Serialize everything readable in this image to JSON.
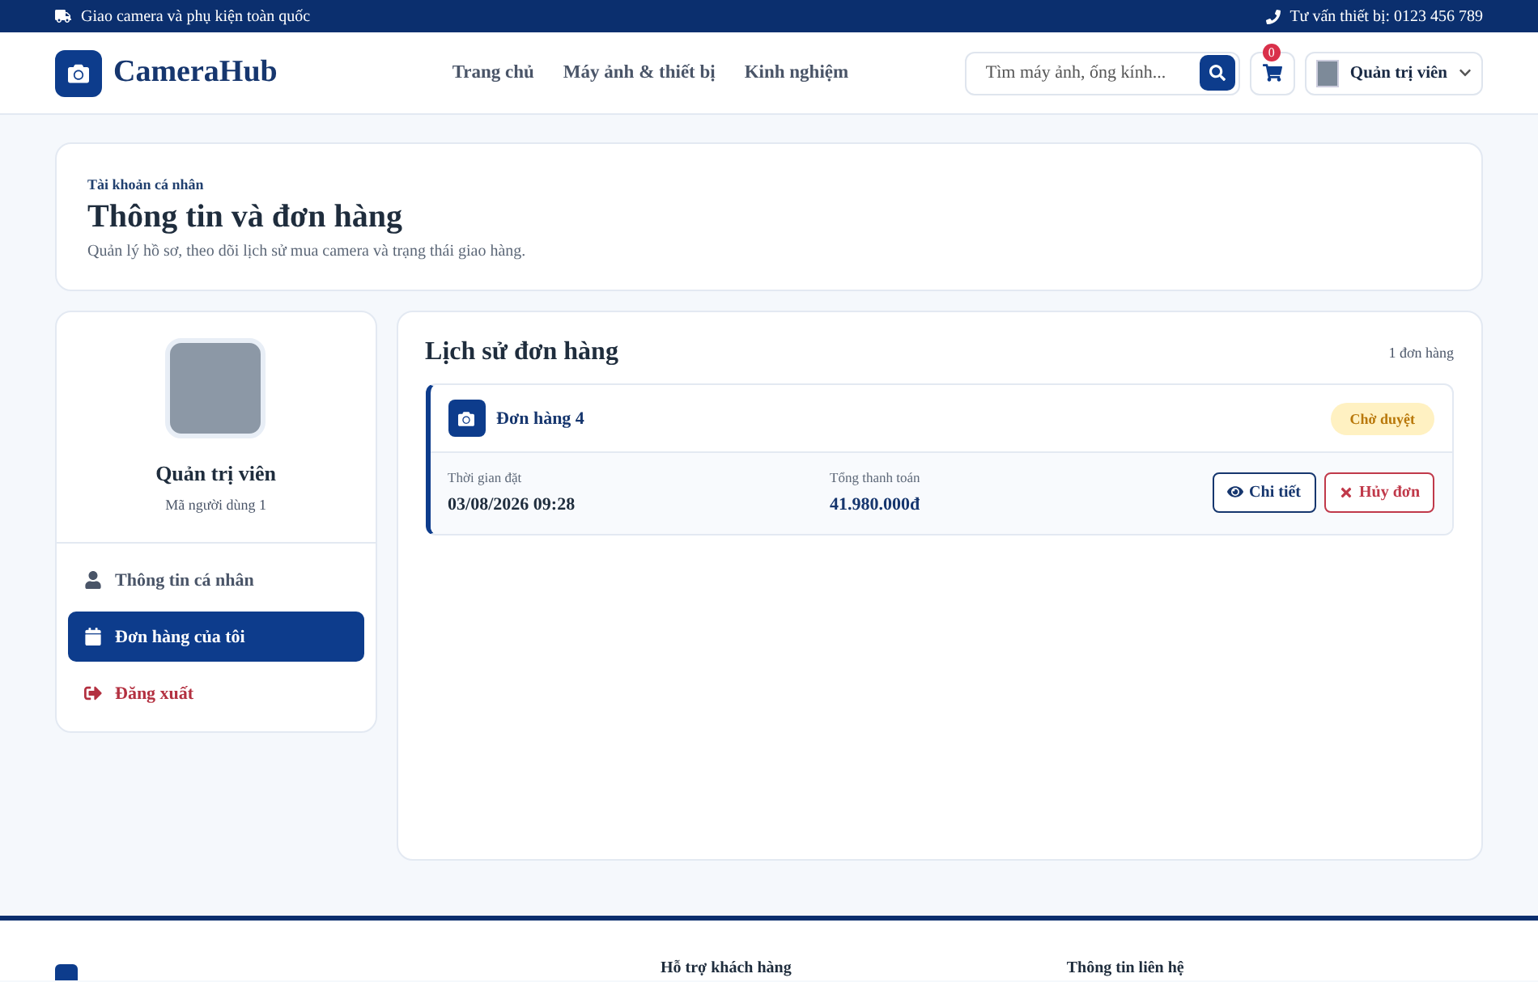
{
  "topbar": {
    "shipping": "Giao camera và phụ kiện toàn quốc",
    "hotline": "Tư vấn thiết bị: 0123 456 789"
  },
  "header": {
    "brand": "CameraHub",
    "nav": [
      {
        "label": "Trang chủ",
        "selected": false
      },
      {
        "label": "Máy ảnh & thiết bị",
        "selected": false
      },
      {
        "label": "Kinh nghiệm",
        "selected": false
      }
    ],
    "search": {
      "placeholder": "Tìm máy ảnh, ống kính..."
    },
    "cart_count": "0",
    "user": "Quản trị viên"
  },
  "hero": {
    "eyebrow": "Tài khoản cá nhân",
    "title": "Thông tin và đơn hàng",
    "subtitle": "Quản lý hồ sơ, theo dõi lịch sử mua camera và trạng thái giao hàng."
  },
  "profile": {
    "name": "Quản trị viên",
    "user_id": "Mã người dùng 1",
    "menu": [
      {
        "kind": "profile",
        "label": "Thông tin cá nhân",
        "selected": false
      },
      {
        "kind": "orders",
        "label": "Đơn hàng của tôi",
        "selected": true
      },
      {
        "kind": "logout",
        "label": "Đăng xuất",
        "selected": false
      }
    ]
  },
  "orders": {
    "title": "Lịch sử đơn hàng",
    "count": "1 đơn hàng",
    "items": [
      {
        "name": "Đơn hàng 4",
        "status": "Chờ duyệt",
        "time_label": "Thời gian đặt",
        "time": "03/08/2026 09:28",
        "total_label": "Tổng thanh toán",
        "total": "41.980.000đ",
        "detail_button": "Chi tiết",
        "cancel_button": "Hủy đơn"
      }
    ]
  },
  "footer": {
    "columns": [
      "Hỗ trợ khách hàng",
      "Thông tin liên hệ"
    ]
  }
}
